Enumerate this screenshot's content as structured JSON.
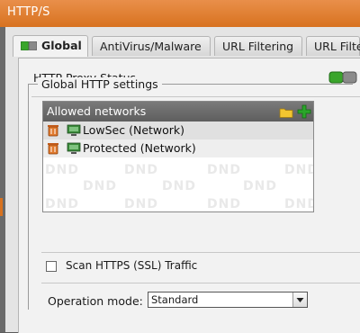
{
  "window": {
    "title": "HTTP/S"
  },
  "tabs": [
    {
      "label": "Global"
    },
    {
      "label": "AntiVirus/Malware"
    },
    {
      "label": "URL Filtering"
    },
    {
      "label": "URL Filte"
    }
  ],
  "status": {
    "label": "HTTP Proxy Status",
    "indicator": "on"
  },
  "global_settings": {
    "legend": "Global HTTP settings",
    "allowed_networks": {
      "header": "Allowed networks",
      "items": [
        {
          "label": "LowSec (Network)"
        },
        {
          "label": "Protected (Network)"
        }
      ],
      "watermark": "DND"
    },
    "scan_https": {
      "label": "Scan HTTPS (SSL) Traffic",
      "checked": false
    },
    "operation_mode": {
      "label": "Operation mode:",
      "value": "Standard"
    }
  },
  "colors": {
    "accent": "#d8721f",
    "status_on": "#3aa52b",
    "status_off": "#7a7a7a",
    "add_green": "#2aa62a",
    "folder_yellow": "#f2c530",
    "delete_orange": "#e07a2e"
  }
}
